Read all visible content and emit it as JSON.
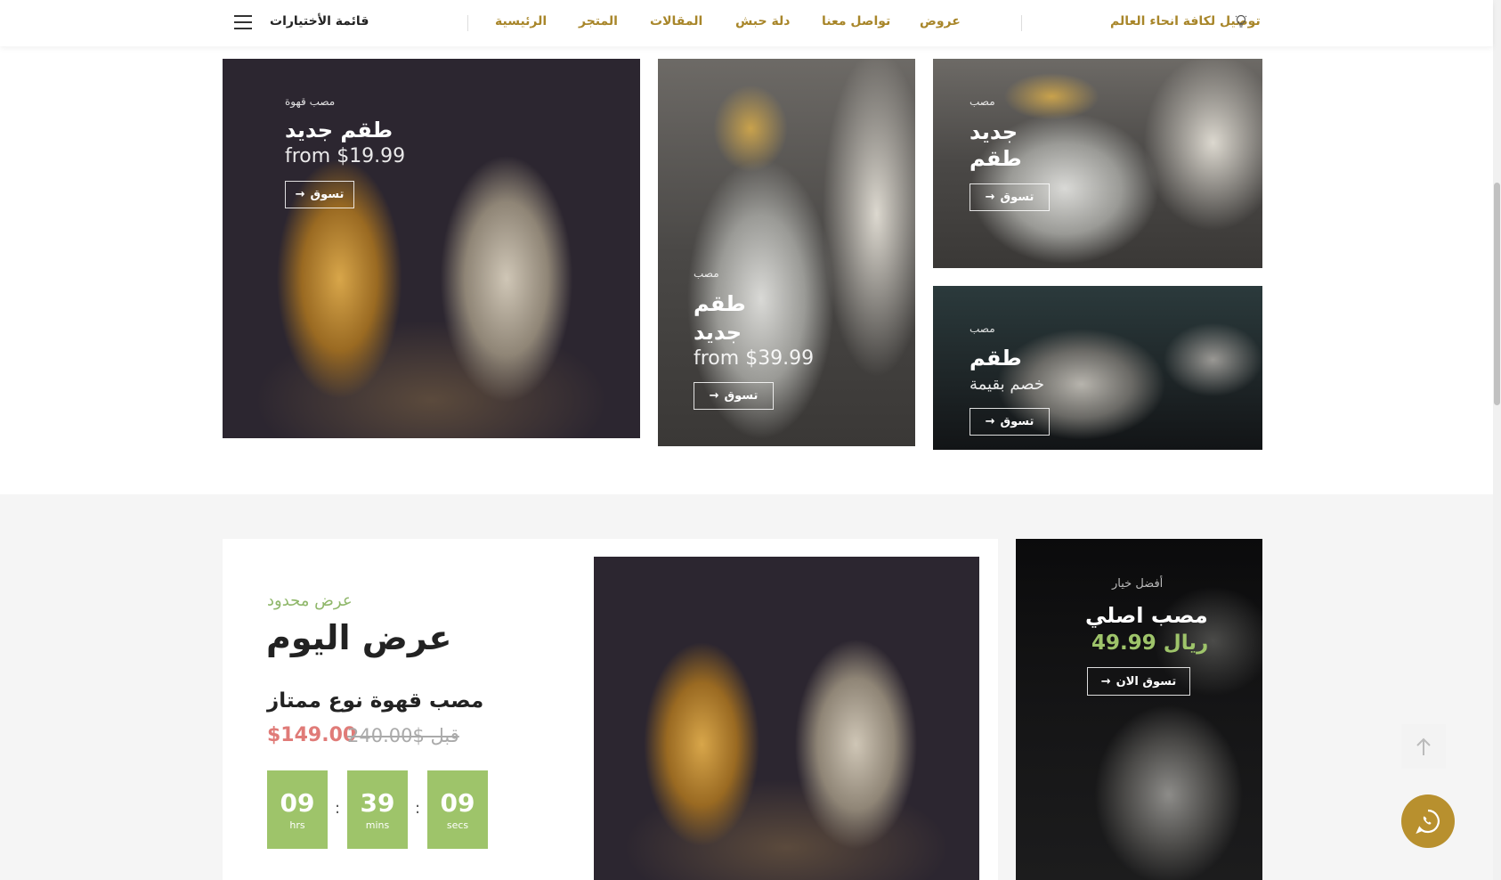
{
  "header": {
    "shipping_text": "توصيل لكافة انحاء العالم",
    "nav": [
      "عروض",
      "تواصل معنا",
      "دلة حبش",
      "المقالات",
      "المتجر",
      "الرئيسية"
    ],
    "menu_label": "قائمة الأختيارات"
  },
  "banners": [
    {
      "small": "مصب قهوة",
      "title": "طقم جديد",
      "price": "from $19.99",
      "button": "تسوق"
    },
    {
      "small": "مصب",
      "title_line1": "طقم",
      "title_line2": "جديد",
      "price": "from $39.99",
      "button": "تسوق"
    },
    {
      "small": "مصب",
      "title_line1": "جديد",
      "title_line2": "طقم",
      "button": "تسوق"
    },
    {
      "small": "مصب",
      "title": "طقم",
      "price": "خصم بقيمة",
      "button": "تسوق"
    }
  ],
  "deal": {
    "subtitle": "عرض محدود",
    "title": "عرض اليوم",
    "product": "مصب قهوة نوع ممتاز",
    "price": "$149.00",
    "old_price": "قبل $240.00",
    "countdown": [
      {
        "value": "09",
        "unit": "hrs"
      },
      {
        "value": "39",
        "unit": "mins"
      },
      {
        "value": "09",
        "unit": "secs"
      }
    ]
  },
  "best": {
    "small": "أفضل خيار",
    "title": "مصب اصلي",
    "price": "49.99 ريال",
    "button": "تسوق الان"
  },
  "colors": {
    "gold": "#a8862a",
    "green": "#9ec46a",
    "sale": "#e07b78",
    "whatsapp": "#b8902e"
  },
  "icons": [
    "menu-icon",
    "bulb-icon",
    "arrow-right-icon",
    "arrow-up-icon",
    "whatsapp-icon"
  ]
}
